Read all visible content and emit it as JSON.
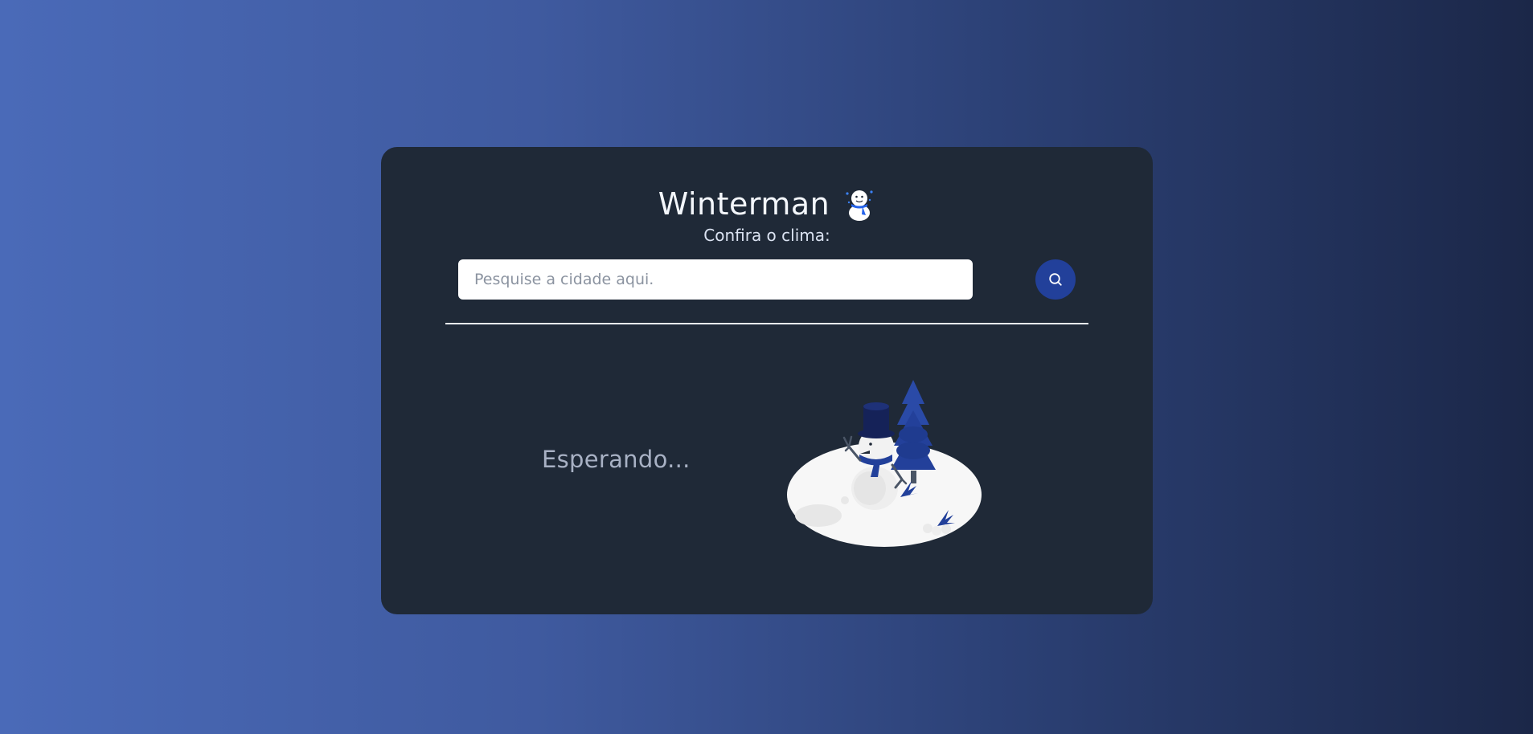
{
  "app": {
    "title": "Winterman",
    "subtitle": "Confira o clima:"
  },
  "search": {
    "placeholder": "Pesquise a cidade aqui.",
    "value": "",
    "button_icon": "search-icon"
  },
  "weather": {
    "status": "Esperando..."
  },
  "icons": {
    "title": "snowman-icon",
    "illustration": "snowman-scene-illustration"
  },
  "colors": {
    "background_start": "#4a6ab8",
    "background_end": "#1b2748",
    "card": "#1f2937",
    "accent": "#22409a",
    "title_text": "#f3f6fb",
    "status_text": "#a8b1c4"
  }
}
